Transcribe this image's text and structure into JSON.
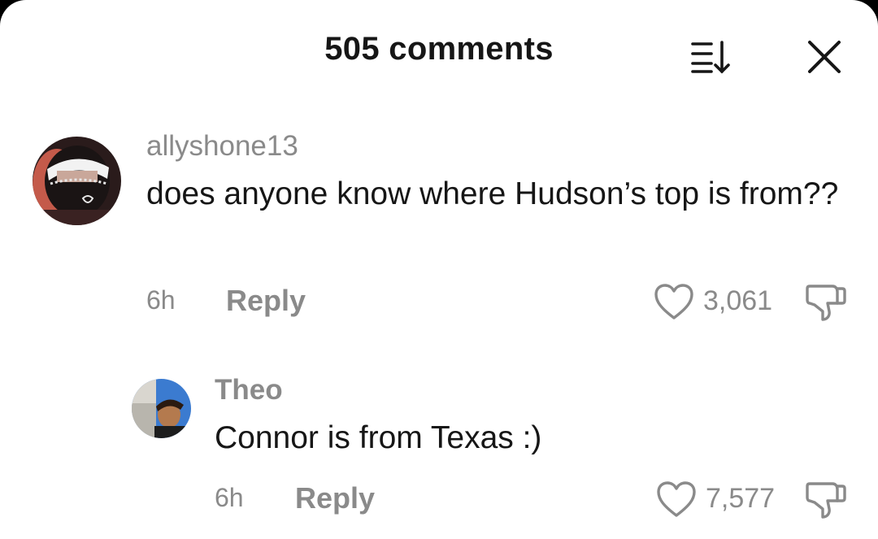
{
  "header": {
    "title": "505 comments"
  },
  "comments": [
    {
      "username": "allyshone13",
      "text": "does anyone know where Hudson’s top is from??",
      "time": "6h",
      "reply_label": "Reply",
      "likes": "3,061"
    },
    {
      "username": "Theo",
      "text": "Connor is from Texas :)",
      "time": "6h",
      "reply_label": "Reply",
      "likes": "7,577"
    }
  ],
  "colors": {
    "background": "#ffffff",
    "primary_text": "#161616",
    "secondary_text": "#8a8a8a"
  },
  "icons": {
    "sort": "sort-icon",
    "close": "close-icon",
    "like": "heart-icon",
    "dislike": "thumbs-down-icon"
  }
}
